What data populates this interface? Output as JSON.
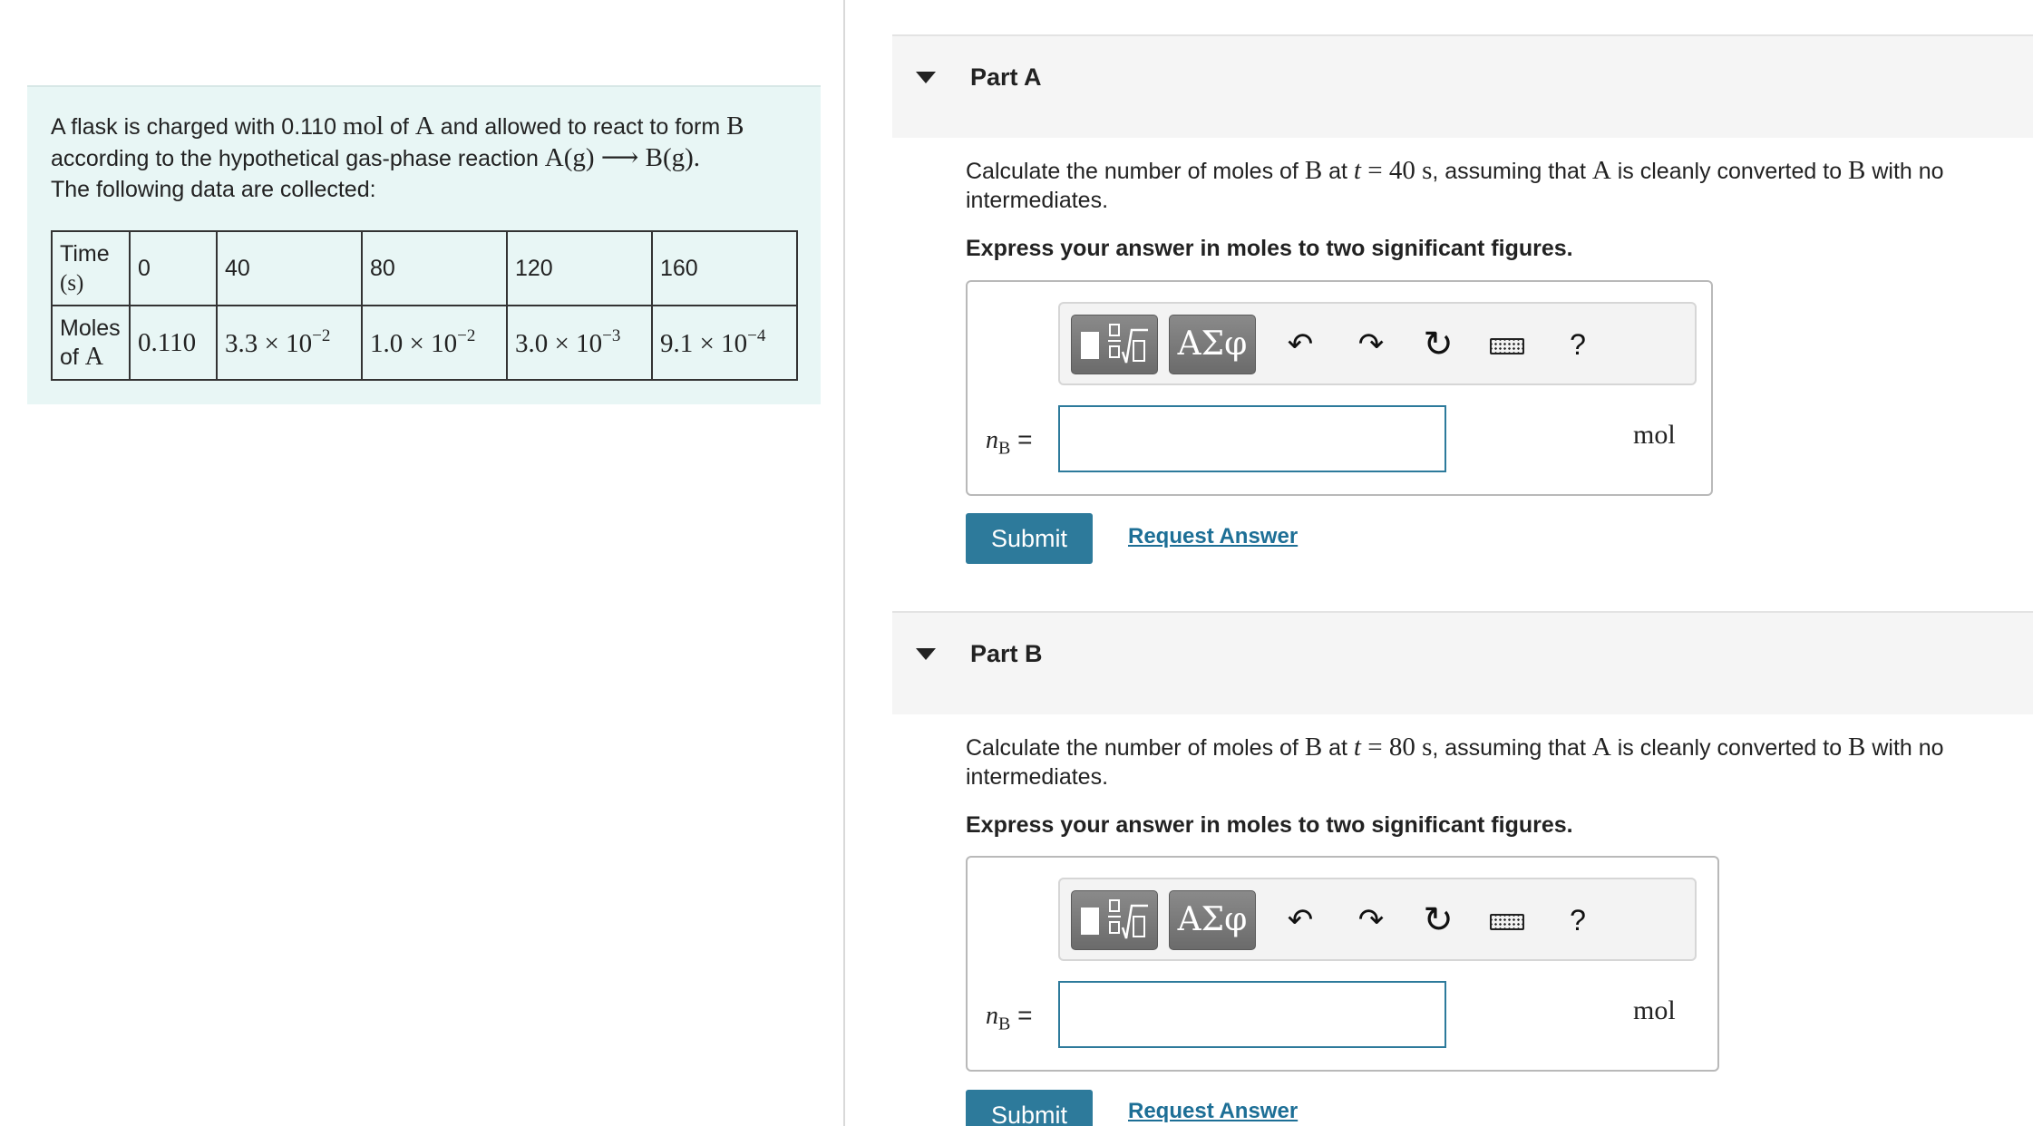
{
  "intro": {
    "t1": "A flask is charged with 0.110 ",
    "mol": "mol",
    "t2": " of ",
    "A": "A",
    "t3": " and allowed to react to form ",
    "B": "B",
    "t4": "according to the hypothetical gas-phase reaction ",
    "reaction": "A(g) ⟶ B(g).",
    "t5": "The following data are collected:"
  },
  "table": {
    "row1_header_1": "Time",
    "row1_header_2": "(s)",
    "times": [
      "0",
      "40",
      "80",
      "120",
      "160"
    ],
    "row2_header_1": "Moles",
    "row2_header_2": "of ",
    "row2_header_A": "A",
    "moles": [
      {
        "base": "0.110",
        "exp": ""
      },
      {
        "base": "3.3 × 10",
        "exp": "−2"
      },
      {
        "base": "1.0 × 10",
        "exp": "−2"
      },
      {
        "base": "3.0 × 10",
        "exp": "−3"
      },
      {
        "base": "9.1 × 10",
        "exp": "−4"
      }
    ]
  },
  "partA": {
    "title": "Part A",
    "q1": "Calculate the number of moles of ",
    "B": "B",
    "q2": " at ",
    "t": "t",
    "q3": " = 40 s",
    "q4": ", assuming that ",
    "A": "A",
    "q5": " is cleanly converted to ",
    "q6": " with no intermediates.",
    "instruction": "Express your answer in moles to two significant figures.",
    "var": "n",
    "var_sub": "B",
    "eq": " =",
    "value": "",
    "unit": "mol",
    "submit": "Submit",
    "request": "Request Answer"
  },
  "partB": {
    "title": "Part B",
    "q1": "Calculate the number of moles of ",
    "B": "B",
    "q2": " at ",
    "t": "t",
    "q3": " = 80 s",
    "q4": ", assuming that ",
    "A": "A",
    "q5": " is cleanly converted to ",
    "q6": " with no intermediates.",
    "instruction": "Express your answer in moles to two significant figures.",
    "var": "n",
    "var_sub": "B",
    "eq": " =",
    "value": "",
    "unit": "mol",
    "submit": "Submit",
    "request": "Request Answer"
  },
  "toolbar": {
    "symbols": "ΑΣφ",
    "undo": "↶",
    "redo": "↷",
    "reset": "↻",
    "help": "?",
    "templates_sqrt": "√",
    "icons": [
      "templates-icon",
      "greek-symbols-icon",
      "undo-icon",
      "redo-icon",
      "reset-icon",
      "keyboard-icon",
      "help-icon"
    ]
  },
  "colors": {
    "intro_bg": "#e8f6f5",
    "accent": "#2d7a9b",
    "link": "#1d6f96",
    "part_header_bg": "#f5f5f5"
  }
}
